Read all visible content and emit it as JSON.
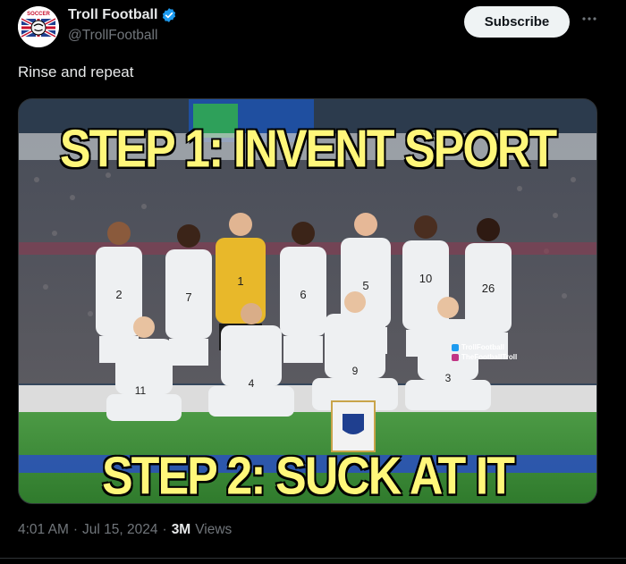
{
  "author": {
    "display_name": "Troll Football",
    "handle": "@TrollFootball",
    "verified": true,
    "avatar_text": "SOCCER"
  },
  "subscribe_label": "Subscribe",
  "tweet_text": "Rinse and repeat",
  "media": {
    "caption_top": "STEP 1: INVENT SPORT",
    "caption_bottom": "STEP 2: SUCK AT IT",
    "watermark_line1": "TrollFootball",
    "watermark_line2": "TheFootballTroll",
    "jersey_numbers_back": [
      "2",
      "7",
      "1",
      "6",
      "5",
      "10",
      "26"
    ],
    "jersey_numbers_front": [
      "11",
      "4",
      "9",
      "3"
    ]
  },
  "meta": {
    "time": "4:01 AM",
    "date": "Jul 15, 2024",
    "views_count": "3M",
    "views_label": "Views"
  },
  "colors": {
    "accent_verified": "#1d9bf0",
    "caption_yellow": "#fff77a",
    "pitch_green": "#3f8a3a",
    "kit_white": "#eef0f2",
    "keeper_yellow": "#e8b82a"
  }
}
